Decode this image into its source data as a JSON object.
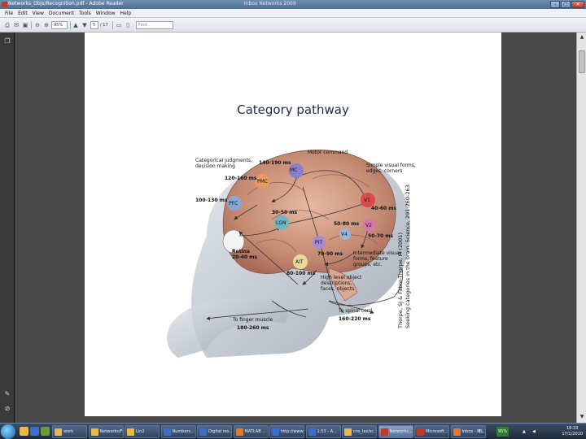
{
  "window": {
    "title": "Networks_Objs/Recognition.pdf - Adobe Reader",
    "title_center": "Inbox Networks 2009"
  },
  "menu": [
    "File",
    "Edit",
    "View",
    "Document",
    "Tools",
    "Window",
    "Help"
  ],
  "toolbar": {
    "zoom_value": "95%",
    "page_current": "5",
    "page_total": "/ 17",
    "find_placeholder": "Find"
  },
  "slide": {
    "title": "Category pathway",
    "labels": {
      "motor_command": "Motor command",
      "mc": "MC",
      "t_140_190": "140-190 ms",
      "categorical": "Categorical judgments,\ndecision making",
      "pmc": "PMC",
      "t_120_160": "120-160 ms",
      "simple_visual": "Simple visual forms,\nedges, corners",
      "pfc": "PFC",
      "t_100_130": "100-130 ms",
      "v1": "V1",
      "t_40_60": "40-60 ms",
      "t_30_50": "30-50 ms",
      "lgn": "LGN",
      "v2": "V2",
      "t_50_80": "50-80 ms",
      "v4": "V4",
      "t_50_70": "50-70 ms",
      "pit": "PIT",
      "retina": "Retina\n20-40 ms",
      "t_70_90": "70-90 ms",
      "intermediate": "Intermediate visual\nforms, feature\ngroups, etc.",
      "ait": "AIT",
      "t_80_100": "80-100 ms",
      "high_level": "High level object\ndescriptions,\nfaces, objects",
      "spinal_cord": "To spinal cord",
      "t_160_220": "160-220 ms",
      "finger_muscle": "To finger muscle",
      "t_180_260": "180-260 ms"
    },
    "citation_line1": "Thorpe, SJ & Fabre-Thorpe, M (2001)",
    "citation_line2": "Seeking categories in the brain. Science, 291:260-263."
  },
  "taskbar": {
    "items": [
      {
        "label": "work",
        "color": "#e8b84a"
      },
      {
        "label": "Networks/Ff...",
        "color": "#e8b84a"
      },
      {
        "label": "Lin2",
        "color": "#e8b84a"
      },
      {
        "label": "Numbers...",
        "color": "#3a6fd0"
      },
      {
        "label": "Digital res...",
        "color": "#3a6fd0"
      },
      {
        "label": "MATLAB ...",
        "color": "#e07a2a"
      },
      {
        "label": "http://www...",
        "color": "#3a6fd0"
      },
      {
        "label": "1.53 - A...",
        "color": "#3a6fd0"
      },
      {
        "label": "cns_las/sc...",
        "color": "#e8b84a"
      },
      {
        "label": "Networks...",
        "color": "#c0392b"
      },
      {
        "label": "Microsoft...",
        "color": "#c0392b"
      },
      {
        "label": "Inbox - M...",
        "color": "#e07a2a"
      }
    ],
    "lang": "EL",
    "battery": "95%",
    "time": "16:33",
    "date": "17/1/2010"
  }
}
